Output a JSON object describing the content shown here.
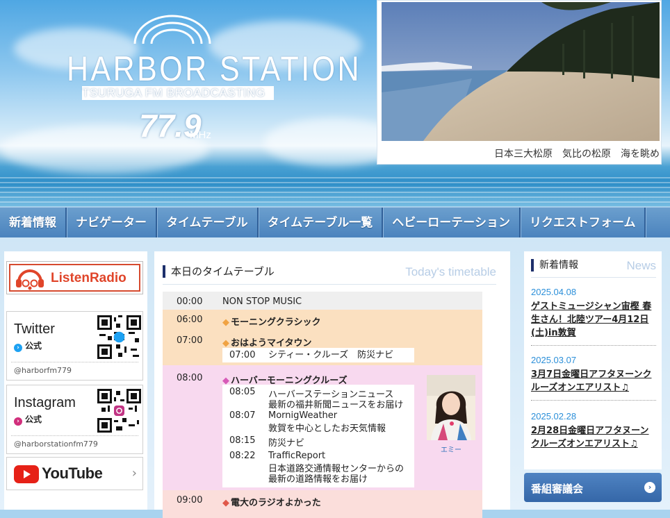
{
  "header": {
    "logo_name": "HARBOR STATION",
    "logo_sub": "TSURUGA FM BROADCASTING",
    "logo_freq": "77.9",
    "logo_mhz": "MHz",
    "photo_caption": "日本三大松原　気比の松原　海を眺め"
  },
  "nav": {
    "items": [
      "新着情報",
      "ナビゲーター",
      "タイムテーブル",
      "タイムテーブル一覧",
      "ヘビーローテーション",
      "リクエストフォーム"
    ]
  },
  "left": {
    "listenradio_label": "ListenRadio",
    "twitter": {
      "title": "Twitter",
      "official": "公式",
      "handle": "@harborfm779"
    },
    "instagram": {
      "title": "Instagram",
      "official": "公式",
      "handle": "@harborstationfm779"
    },
    "youtube_label": "YouTube",
    "youtube_chevron": "›"
  },
  "timetable": {
    "title": "本日のタイムテーブル",
    "title_en": "Today's timetable",
    "rows": [
      {
        "time": "00:00",
        "program": "NON STOP MUSIC",
        "color": "#efefef"
      },
      {
        "time": "06:00",
        "program": "モーニングクラシック",
        "color": "#fbe0c0"
      },
      {
        "time": "07:00",
        "program": "おはようマイタウン",
        "color": "#fbe0c0"
      },
      {
        "time": "08:00",
        "program": "ハーバーモーニングクルーズ",
        "color": "#f8d9ef"
      },
      {
        "time": "09:00",
        "program": "電大のラジオよかった",
        "color": "#fbdedb"
      }
    ],
    "diamond": "◆",
    "sub_0700": [
      {
        "time": "07:00",
        "name": "シティー・クルーズ　防災ナビ"
      }
    ],
    "sub_0800": [
      {
        "time": "08:05",
        "name": "ハーバーステーションニュース",
        "desc": "最新の福井新聞ニュースをお届け"
      },
      {
        "time": "08:07",
        "name": "MornigWeather",
        "desc": "敦賀を中心としたお天気情報"
      },
      {
        "time": "08:15",
        "name": "防災ナビ",
        "desc": ""
      },
      {
        "time": "08:22",
        "name": "TrafficReport",
        "desc": "日本道路交通情報センターからの"
      },
      {
        "time": "",
        "name": "",
        "desc": "最新の道路情報をお届け"
      }
    ],
    "navigator_name": "エミー"
  },
  "news": {
    "title": "新着情報",
    "title_en": "News",
    "items": [
      {
        "date": "2025.04.08",
        "text": "ゲストミュージシャン宙樫 春生さん！北陸ツアー4月12日(土)in敦賀"
      },
      {
        "date": "2025.03.07",
        "text": "3月7日金曜日アフタヌーンクルーズオンエアリスト♫"
      },
      {
        "date": "2025.02.28",
        "text": "2月28日金曜日アフタヌーンクルーズオンエアリスト♫"
      }
    ]
  },
  "council": {
    "label": "番組審議会",
    "arrow": "›"
  }
}
